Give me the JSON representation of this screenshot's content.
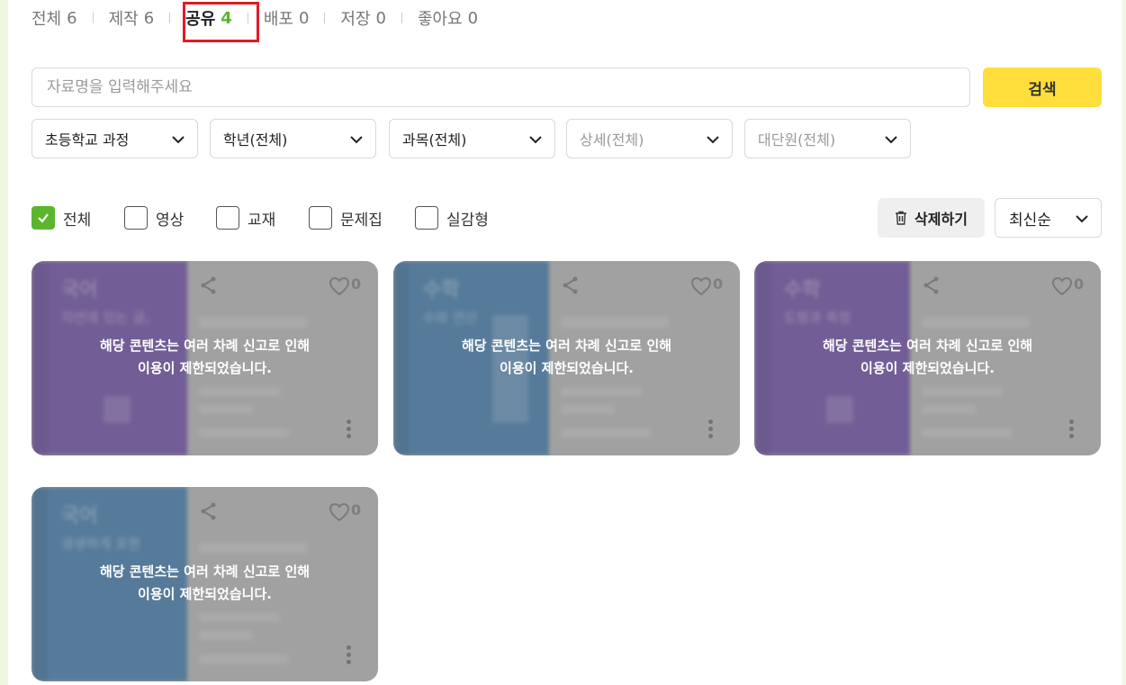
{
  "tabs": [
    {
      "label": "전체",
      "count": "6"
    },
    {
      "label": "제작",
      "count": "6"
    },
    {
      "label": "공유",
      "count": "4"
    },
    {
      "label": "배포",
      "count": "0"
    },
    {
      "label": "저장",
      "count": "0"
    },
    {
      "label": "좋아요",
      "count": "0"
    }
  ],
  "active_tab": "공유",
  "search": {
    "placeholder": "자료명을 입력해주세요",
    "value": "",
    "button_label": "검색"
  },
  "filters": [
    {
      "value": "초등학교 과정",
      "enabled": true
    },
    {
      "value": "학년(전체)",
      "enabled": true
    },
    {
      "value": "과목(전체)",
      "enabled": true
    },
    {
      "value": "상세(전체)",
      "enabled": false
    },
    {
      "value": "대단원(전체)",
      "enabled": false
    }
  ],
  "types": [
    {
      "label": "전체",
      "checked": true
    },
    {
      "label": "영상",
      "checked": false
    },
    {
      "label": "교재",
      "checked": false
    },
    {
      "label": "문제집",
      "checked": false
    },
    {
      "label": "실감형",
      "checked": false
    }
  ],
  "toolbar": {
    "delete_label": "삭제하기",
    "sort_value": "최신순"
  },
  "cards": [
    {
      "subject": "국어",
      "subtitle": "자연에 있는 글,",
      "color": "purple",
      "likes": "0",
      "message_line1": "해당 콘텐츠는 여러 차례 신고로 인해",
      "message_line2": "이용이 제한되었습니다."
    },
    {
      "subject": "수학",
      "subtitle": "수와 연산",
      "color": "blue",
      "likes": "0",
      "message_line1": "해당 콘텐츠는 여러 차례 신고로 인해",
      "message_line2": "이용이 제한되었습니다."
    },
    {
      "subject": "수학",
      "subtitle": "도형과 측정",
      "color": "purple",
      "likes": "0",
      "message_line1": "해당 콘텐츠는 여러 차례 신고로 인해",
      "message_line2": "이용이 제한되었습니다."
    },
    {
      "subject": "국어",
      "subtitle": "생생하게 표현",
      "color": "blue",
      "likes": "0",
      "message_line1": "해당 콘텐츠는 여러 차례 신고로 인해",
      "message_line2": "이용이 제한되었습니다."
    }
  ],
  "colors": {
    "accent_green": "#5bb52e",
    "search_yellow": "#ffde3b",
    "highlight_red": "#e01b24",
    "card_purple": "#6b4aa1",
    "card_blue": "#3f78a8"
  }
}
